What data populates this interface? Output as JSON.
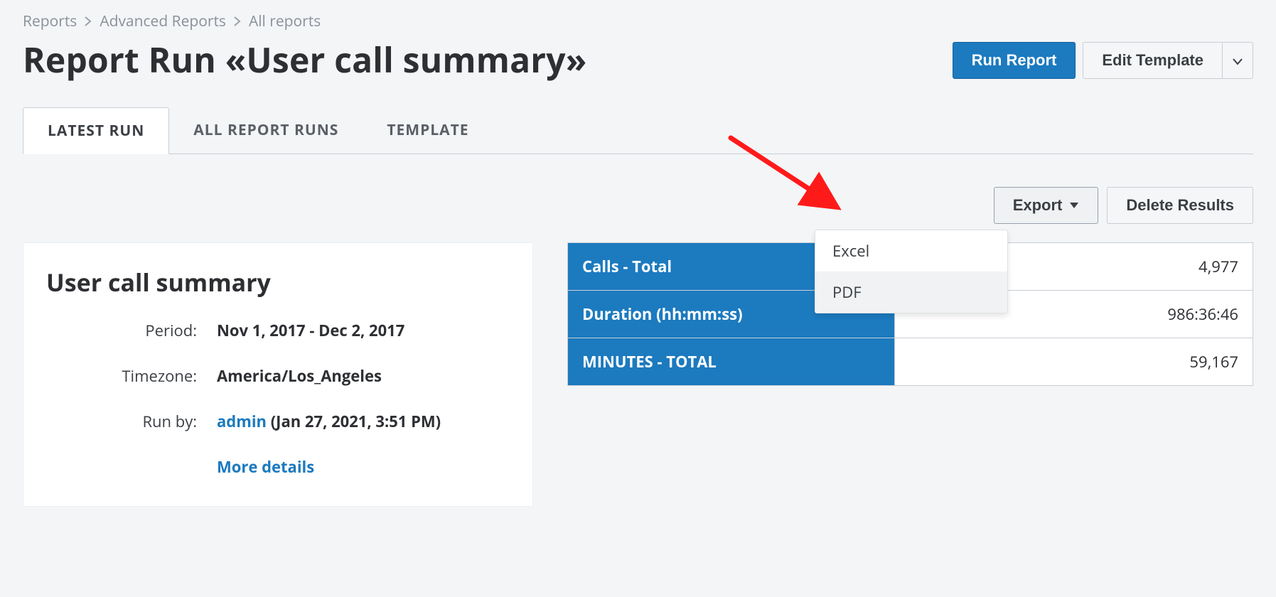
{
  "breadcrumb": {
    "items": [
      "Reports",
      "Advanced Reports",
      "All reports"
    ]
  },
  "header": {
    "title": "Report Run «User call summary»",
    "run_button": "Run Report",
    "edit_button": "Edit Template"
  },
  "tabs": [
    {
      "label": "LATEST RUN",
      "active": true
    },
    {
      "label": "ALL REPORT RUNS",
      "active": false
    },
    {
      "label": "TEMPLATE",
      "active": false
    }
  ],
  "actions": {
    "export_label": "Export",
    "delete_label": "Delete Results",
    "export_menu": [
      "Excel",
      "PDF"
    ]
  },
  "summary": {
    "title": "User call summary",
    "period_label": "Period:",
    "period_value": "Nov 1, 2017 - Dec 2, 2017",
    "timezone_label": "Timezone:",
    "timezone_value": "America/Los_Angeles",
    "runby_label": "Run by:",
    "runby_user": "admin",
    "runby_time": "(Jan 27, 2021, 3:51 PM)",
    "more_details": "More details"
  },
  "metrics": [
    {
      "label": "Calls - Total",
      "value": "4,977"
    },
    {
      "label": "Duration (hh:mm:ss)",
      "value": "986:36:46"
    },
    {
      "label": "MINUTES - TOTAL",
      "value": "59,167"
    }
  ]
}
